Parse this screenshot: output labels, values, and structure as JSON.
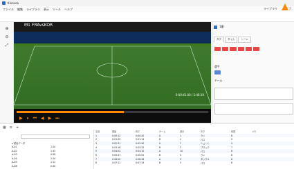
{
  "app": {
    "title": "Kinovea",
    "accent": "#ff8a00"
  },
  "menu": [
    "ファイル",
    "編集",
    "ライブラリ",
    "表示",
    "ツール",
    "ヘルプ"
  ],
  "topright": {
    "library": "ライブラリ",
    "live": "ライブ"
  },
  "video": {
    "title": "M1 FRAvsKOR",
    "timecode": "0:00:41.00 / 1:46:10"
  },
  "right": {
    "file_label": "1番",
    "tabs": [
      "タグ",
      "タイム",
      "シーン"
    ],
    "tag_rows_red": [
      "",
      "",
      "",
      "",
      "",
      ""
    ],
    "section_player": "選手",
    "section_team": "チーム",
    "sections": [
      "共通",
      "攻撃",
      "守備"
    ],
    "bottom_labels": [
      "データ",
      "タイム",
      "スコア"
    ]
  },
  "tree": {
    "header": [
      "名前",
      "時間"
    ],
    "root": "▸ 試合データ",
    "rows": [
      {
        "name": "A-01",
        "value": "1:20"
      },
      {
        "name": "A-02",
        "value": "1:45"
      },
      {
        "name": "A-03",
        "value": "0:58"
      },
      {
        "name": "A-04",
        "value": "2:10"
      },
      {
        "name": "A-05",
        "value": "1:12"
      },
      {
        "name": "A-06",
        "value": "0:40"
      }
    ]
  },
  "grid": {
    "headers": [
      "名前",
      "開始",
      "終了",
      "チーム",
      "選手",
      "タグ",
      "時間",
      "メモ"
    ],
    "rows": [
      [
        "1",
        "0:00:12",
        "0:00:20",
        "A",
        "1",
        "ラン",
        "8",
        ""
      ],
      [
        "2",
        "0:01:05",
        "0:01:14",
        "B",
        "4",
        "パス",
        "9",
        ""
      ],
      [
        "3",
        "0:02:31",
        "0:02:40",
        "A",
        "7",
        "シュート",
        "9",
        ""
      ],
      [
        "4",
        "0:03:18",
        "0:03:25",
        "B",
        "2",
        "ブロック",
        "7",
        ""
      ],
      [
        "5",
        "0:04:02",
        "0:04:10",
        "A",
        "10",
        "パス",
        "8",
        ""
      ],
      [
        "6",
        "0:05:47",
        "0:05:55",
        "B",
        "5",
        "ラン",
        "8",
        ""
      ],
      [
        "7",
        "0:06:20",
        "0:06:28",
        "A",
        "9",
        "タックル",
        "8",
        ""
      ],
      [
        "8",
        "0:07:11",
        "0:07:19",
        "B",
        "3",
        "パス",
        "8",
        ""
      ]
    ]
  }
}
